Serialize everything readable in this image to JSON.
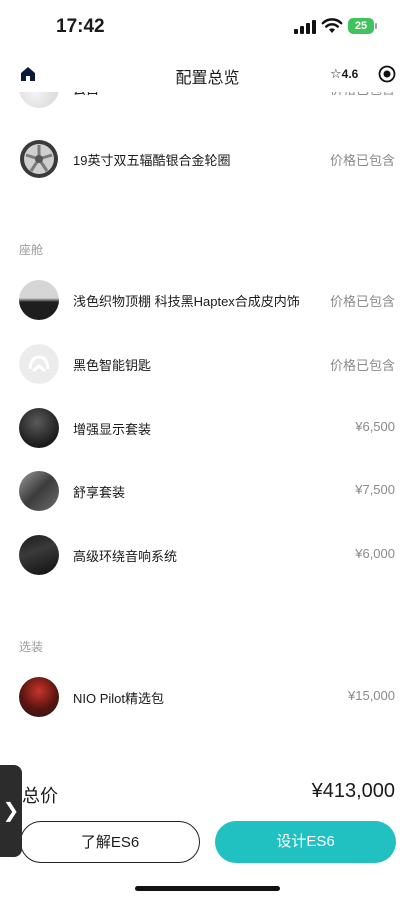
{
  "status": {
    "time": "17:42",
    "battery": "25"
  },
  "nav": {
    "title": "配置总览",
    "rating": "4.6"
  },
  "partial_row": {
    "name": "云白",
    "price": "价格已包含"
  },
  "wheel_row": {
    "name": "19英寸双五辐酷银合金轮圈",
    "price": "价格已包含"
  },
  "cabin": {
    "label": "座舱",
    "items": [
      {
        "name": "浅色织物顶棚 科技黑Haptex合成皮内饰",
        "price": "价格已包含"
      },
      {
        "name": "黑色智能钥匙",
        "price": "价格已包含"
      },
      {
        "name": "增强显示套装",
        "price": "¥6,500"
      },
      {
        "name": "舒享套装",
        "price": "¥7,500"
      },
      {
        "name": "高级环绕音响系统",
        "price": "¥6,000"
      }
    ]
  },
  "options": {
    "label": "选装",
    "items": [
      {
        "name": "NIO Pilot精选包",
        "price": "¥15,000"
      }
    ]
  },
  "footer": {
    "total_label": "总价",
    "total_value": "¥413,000",
    "learn_button": "了解ES6",
    "design_button": "设计ES6"
  },
  "side_handle": "❯",
  "colors": {
    "accent": "#21c1c2",
    "battery": "#3fc45d"
  },
  "icons": [
    "home-icon",
    "star-icon",
    "record-icon",
    "signal-icon",
    "wifi-icon",
    "battery-icon"
  ]
}
